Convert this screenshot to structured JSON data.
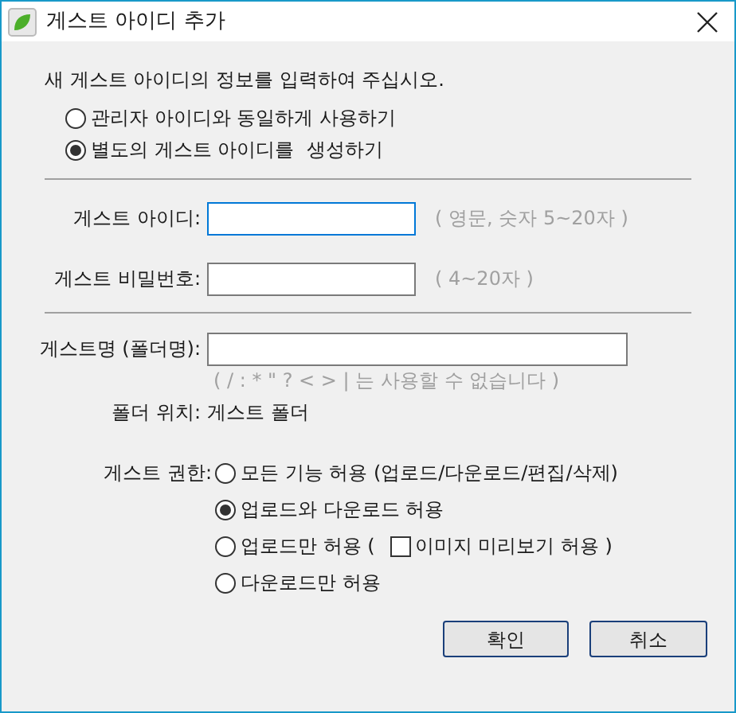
{
  "window": {
    "title": "게스트 아이디 추가"
  },
  "intro": "새 게스트 아이디의 정보를 입력하여 주십시오.",
  "id_mode": [
    {
      "label": "관리자 아이디와 동일하게 사용하기",
      "selected": false
    },
    {
      "label": "별도의 게스트 아이디를  생성하기",
      "selected": true
    }
  ],
  "fields": [
    {
      "label": "게스트 아이디:",
      "hint": "( 영문, 숫자 5~20자 )",
      "focused": true
    },
    {
      "label": "게스트 비밀번호:",
      "hint": "( 4~20자 )",
      "focused": false
    }
  ],
  "name_field": {
    "label": "게스트명 (폴더명):",
    "note": "( / : * \" ? < > | 는 사용할 수 없습니다 )"
  },
  "folder": {
    "label": "폴더 위치:",
    "value": "게스트 폴더"
  },
  "permissions": {
    "label": "게스트 권한:",
    "options": [
      {
        "kind": "plain",
        "label": "모든 기능 허용 (업로드/다운로드/편집/삭제)",
        "selected": false
      },
      {
        "kind": "plain",
        "label": "업로드와 다운로드 허용",
        "selected": true
      },
      {
        "kind": "with_option",
        "label": "업로드만 허용 (",
        "selected": false,
        "option": {
          "label": "이미지 미리보기 허용 )",
          "checked": false
        }
      },
      {
        "kind": "plain",
        "label": "다운로드만 허용",
        "selected": false
      }
    ]
  },
  "buttons": [
    "확인",
    "취소"
  ]
}
